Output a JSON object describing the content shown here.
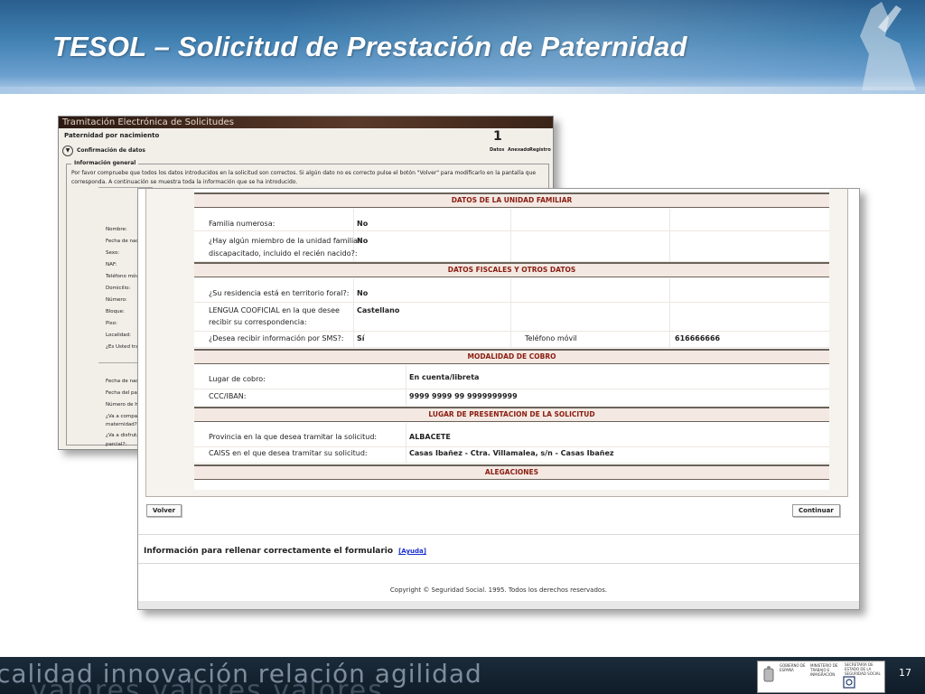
{
  "slide": {
    "title": "TESOL – Solicitud de Prestación de Paternidad",
    "page_number": "17"
  },
  "back_window": {
    "title_bar": "Tramitación Electrónica de Solicitudes",
    "subtitle": "Paternidad por nacimiento",
    "section": "Confirmación de datos",
    "steps": {
      "number": "1",
      "labels": [
        "Datos",
        "Anexado",
        "Registro"
      ]
    },
    "fieldset_legend": "Información general",
    "description": "Por favor compruebe que todos los datos introducidos en la solicitud son correctos. Si algún dato no es correcto pulse el botón \"Volver\" para modificarlo en la pantalla que corresponda. A continuación se muestra toda la información que se ha introducido.",
    "labels": [
      "Nombre:",
      "Fecha de nac",
      "Sexo:",
      "NAF:",
      "Teléfono móv",
      "Domicilio:",
      "Número:",
      "Bloque:",
      "Piso:",
      "Localidad:",
      "¿Es Usted tra",
      "Fecha de nac",
      "Fecha del part",
      "Número de hi",
      "¿Va a compa",
      "maternidad?:",
      "¿Va a disfruta",
      "parcial?:"
    ]
  },
  "form": {
    "sections": {
      "unidad_familiar": "DATOS DE LA UNIDAD FAMILIAR",
      "fiscales": "DATOS FISCALES Y OTROS DATOS",
      "cobro": "MODALIDAD DE COBRO",
      "presentacion": "LUGAR DE PRESENTACION DE LA SOLICITUD",
      "alegaciones": "ALEGACIONES"
    },
    "familia_numerosa": {
      "label": "Familia numerosa:",
      "value": "No"
    },
    "discapacitado": {
      "label_line1": "¿Hay algún miembro de la unidad familiar",
      "label_line2": "discapacitado, incluido el recién nacido?:",
      "value": "No"
    },
    "territorio_foral": {
      "label": "¿Su residencia está en territorio foral?:",
      "value": "No"
    },
    "lengua": {
      "label_line1": "LENGUA COOFICIAL en la que desee",
      "label_line2": "recibir su correspondencia:",
      "value": "Castellano"
    },
    "sms": {
      "label": "¿Desea recibir información por SMS?:",
      "value": "Sí",
      "phone_label": "Teléfono móvil",
      "phone_value": "616666666"
    },
    "lugar_cobro": {
      "label": "Lugar de cobro:",
      "value": "En cuenta/libreta"
    },
    "ccc": {
      "label": "CCC/IBAN:",
      "value": "9999 9999 99 9999999999"
    },
    "provincia": {
      "label": "Provincia en la que desea tramitar la solicitud:",
      "value": "ALBACETE"
    },
    "caiss": {
      "label": "CAISS en el que desea tramitar su solicitud:",
      "value": "Casas Ibañez - Ctra. Villamalea, s/n - Casas Ibañez"
    },
    "buttons": {
      "back": "Volver",
      "continue": "Continuar"
    },
    "help": {
      "text": "Información para rellenar correctamente el formulario",
      "link": "[Ayuda]"
    },
    "copyright": "Copyright © Seguridad Social. 1995. Todos los derechos reservados."
  },
  "footer": {
    "words_top": "calidad   innovación   relación   agilidad",
    "words_bottom": "valores   valores   valores",
    "logo_texts": [
      "GOBIERNO DE ESPAÑA",
      "MINISTERIO DE TRABAJO E INMIGRACIÓN",
      "SECRETARÍA DE ESTADO DE LA SEGURIDAD SOCIAL"
    ]
  },
  "colors": {
    "header_blue": "#3f7fb0",
    "section_red": "#8a1c12",
    "link_blue": "#1a2fd0",
    "footer_dark": "#142433"
  }
}
